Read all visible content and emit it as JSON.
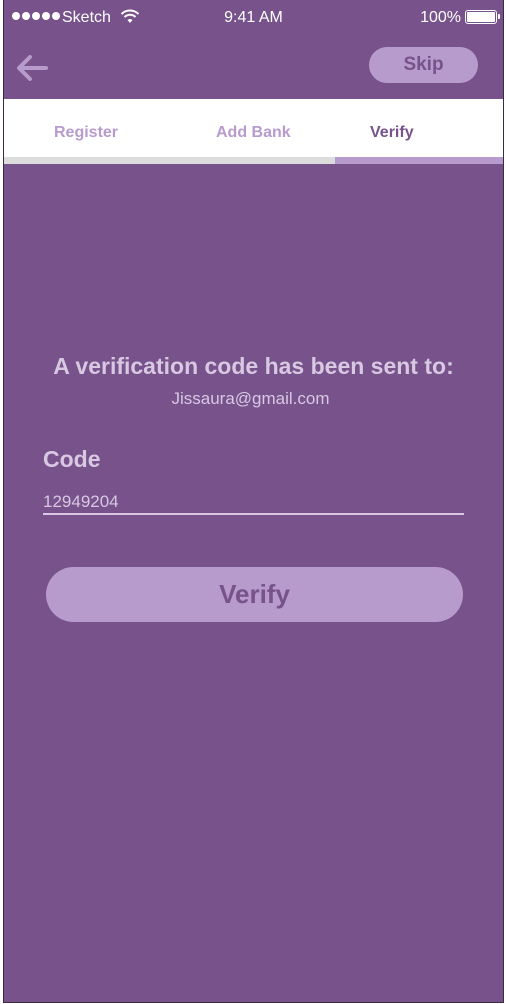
{
  "status_bar": {
    "carrier": "Sketch",
    "time": "9:41 AM",
    "battery": "100%"
  },
  "nav": {
    "skip_label": "Skip"
  },
  "tabs": [
    {
      "label": "Register"
    },
    {
      "label": "Add Bank"
    },
    {
      "label": "Verify"
    }
  ],
  "progress": {
    "current_step": 3,
    "total_steps": 3
  },
  "content": {
    "headline": "A verification code has been sent to:",
    "email": "Jissaura@gmail.com",
    "code_label": "Code",
    "code_value": "12949204",
    "verify_label": "Verify"
  },
  "colors": {
    "background": "#77528b",
    "accent": "#b79bcc",
    "text_light": "#d8c8e2",
    "tab_bar": "#ffffff"
  }
}
